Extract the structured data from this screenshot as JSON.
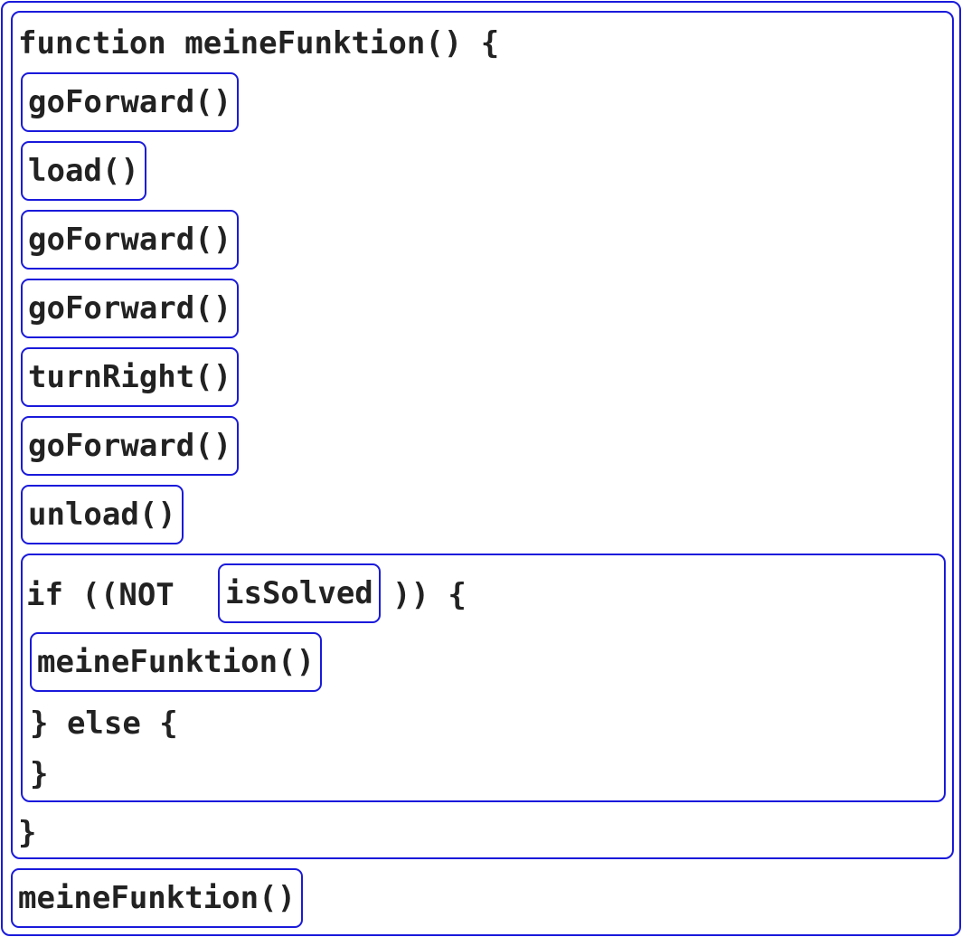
{
  "function_block": {
    "header": "function meineFunktion() {",
    "statements": [
      "goForward()",
      "load()",
      "goForward()",
      "goForward()",
      "turnRight()",
      "goForward()",
      "unload()"
    ],
    "if_block": {
      "prefix": "if ((NOT ",
      "condition": "isSolved",
      "suffix": ")) {",
      "then_call": "meineFunktion()",
      "else_line": "} else {",
      "end_line": "}"
    },
    "closing": "}"
  },
  "main_call": "meineFunktion()",
  "colors": {
    "block_border": "#1a1adb",
    "text": "#222222",
    "background": "#ffffff"
  }
}
